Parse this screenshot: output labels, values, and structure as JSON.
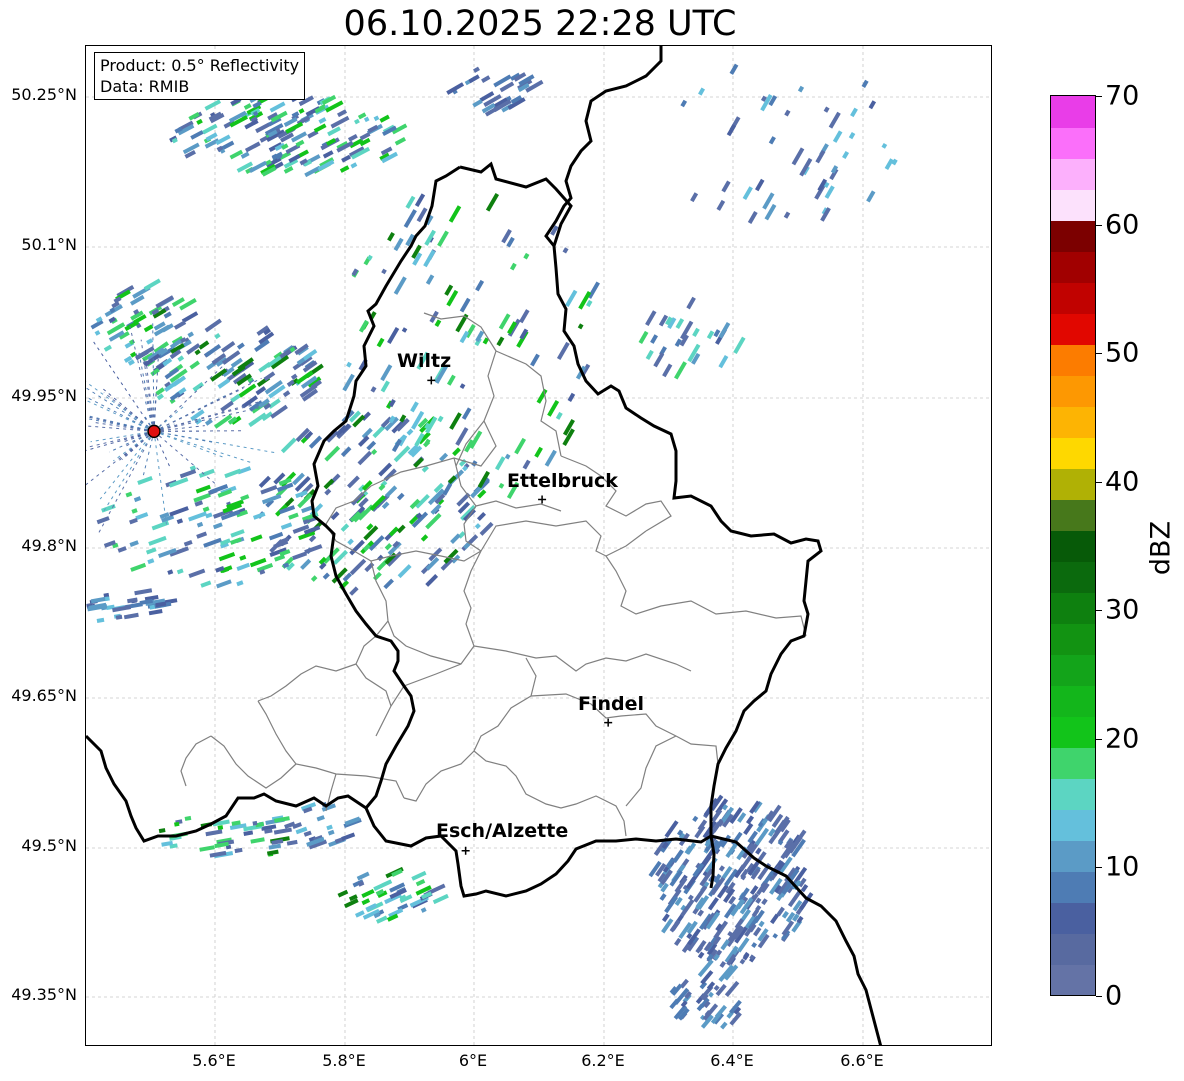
{
  "title": "06.10.2025 22:28 UTC",
  "info": {
    "product": "Product: 0.5° Reflectivity",
    "data_source": "Data: RMIB"
  },
  "latitude_labels": [
    "50.25°N",
    "50.1°N",
    "49.95°N",
    "49.8°N",
    "49.65°N",
    "49.5°N",
    "49.35°N"
  ],
  "longitude_labels": [
    "5.6°E",
    "5.8°E",
    "6°E",
    "6.2°E",
    "6.4°E",
    "6.6°E"
  ],
  "cities": [
    {
      "name": "Wiltz",
      "lat": 49.966,
      "lon": 5.933
    },
    {
      "name": "Ettelbruck",
      "lat": 49.847,
      "lon": 6.104
    },
    {
      "name": "Findel",
      "lat": 49.624,
      "lon": 6.206
    },
    {
      "name": "Esch/Alzette",
      "lat": 49.496,
      "lon": 5.986
    }
  ],
  "radar_site": {
    "lat": 49.915,
    "lon": 5.505
  },
  "map_extent": {
    "lon_min": 5.4,
    "lon_max": 6.8,
    "lat_min": 49.3,
    "lat_max": 50.3
  },
  "colorbar": {
    "label": "dBZ",
    "min": 0,
    "max": 70,
    "tick_labels": [
      "70",
      "60",
      "50",
      "40",
      "30",
      "20",
      "10",
      "0"
    ],
    "colors_low_to_high": [
      "#6473a6",
      "#586aa0",
      "#4a60a0",
      "#4e7cb4",
      "#5b9bc6",
      "#64c0dc",
      "#5cd5c2",
      "#3fd46c",
      "#12c41a",
      "#13b61b",
      "#13a41a",
      "#129312",
      "#0e800f",
      "#0b6a0d",
      "#075a08",
      "#47781b",
      "#b0b105",
      "#fed800",
      "#fdb403",
      "#fd9802",
      "#fc7c00",
      "#e10700",
      "#c10200",
      "#a10000",
      "#7c0000",
      "#fce1fc",
      "#fcb0fc",
      "#fb6ffa",
      "#e93de8"
    ]
  }
}
